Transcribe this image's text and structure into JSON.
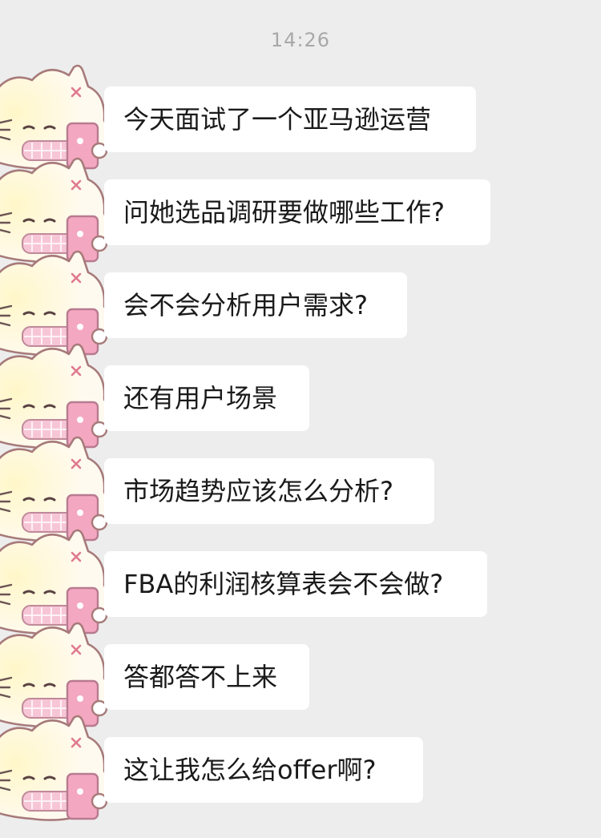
{
  "header": {
    "time": "14:26"
  },
  "avatar_icon": "kitten-avatar-icon",
  "colors": {
    "background": "#ededed",
    "bubble": "#ffffff",
    "text": "#1a1a1a",
    "timestamp": "#a8a8a8"
  },
  "messages": [
    {
      "text": "今天面试了一个亚马逊运营"
    },
    {
      "text": "问她选品调研要做哪些工作?"
    },
    {
      "text": "会不会分析用户需求?"
    },
    {
      "text": "还有用户场景"
    },
    {
      "text": "市场趋势应该怎么分析?"
    },
    {
      "text": "FBA的利润核算表会不会做?"
    },
    {
      "text": "答都答不上来"
    },
    {
      "text": "这让我怎么给offer啊?"
    }
  ]
}
